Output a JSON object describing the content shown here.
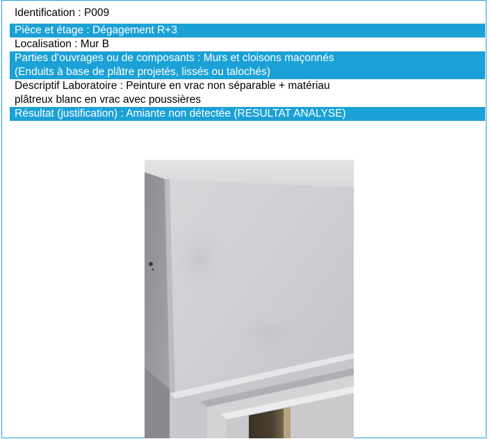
{
  "record": {
    "identification": "Identification : P009",
    "piece_etage": "Pièce et étage : Dégagement R+3",
    "localisation": "Localisation : Mur B",
    "parties_line1": "Parties d'ouvrages ou de composants : Murs et cloisons maçonnés",
    "parties_line2": "(Enduits à base de plâtre projetés, lissés ou talochés)",
    "descriptif_line1": "Descriptif Laboratoire : Peinture en vrac non séparable + matériau",
    "descriptif_line2": "plâtreux blanc en vrac avec poussières",
    "resultat": "Résultat (justification) : Amiante non détectée (RESULTAT ANALYSE)"
  },
  "colors": {
    "accent": "#1ba1d6",
    "text": "#000000",
    "text_on_accent": "#ffffff"
  }
}
